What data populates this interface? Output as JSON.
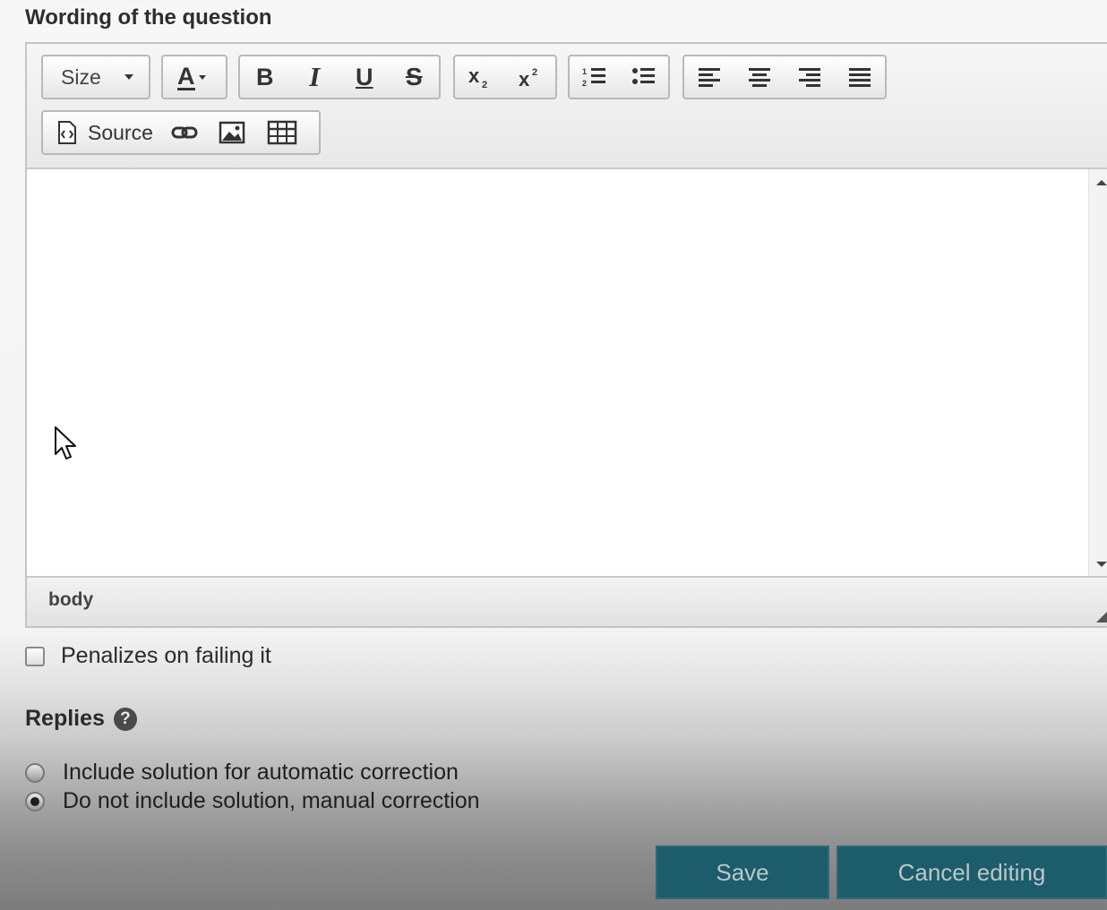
{
  "form": {
    "question_label": "Wording of the question",
    "penalizes_label": "Penalizes on failing it",
    "penalizes_checked": false,
    "replies_label": "Replies",
    "help_glyph": "?",
    "options": [
      {
        "label": "Include solution for automatic correction",
        "selected": false
      },
      {
        "label": "Do not include solution, manual correction",
        "selected": true
      }
    ],
    "save_label": "Save",
    "cancel_label": "Cancel editing"
  },
  "editor": {
    "toolbar": {
      "size_label": "Size",
      "font_color_label": "A",
      "bold_label": "B",
      "italic_label": "I",
      "underline_label": "U",
      "strike_label": "S",
      "source_label": "Source"
    },
    "path_label": "body"
  },
  "colors": {
    "button_bg": "#1d5c6a",
    "button_text": "#b9c8cc"
  }
}
